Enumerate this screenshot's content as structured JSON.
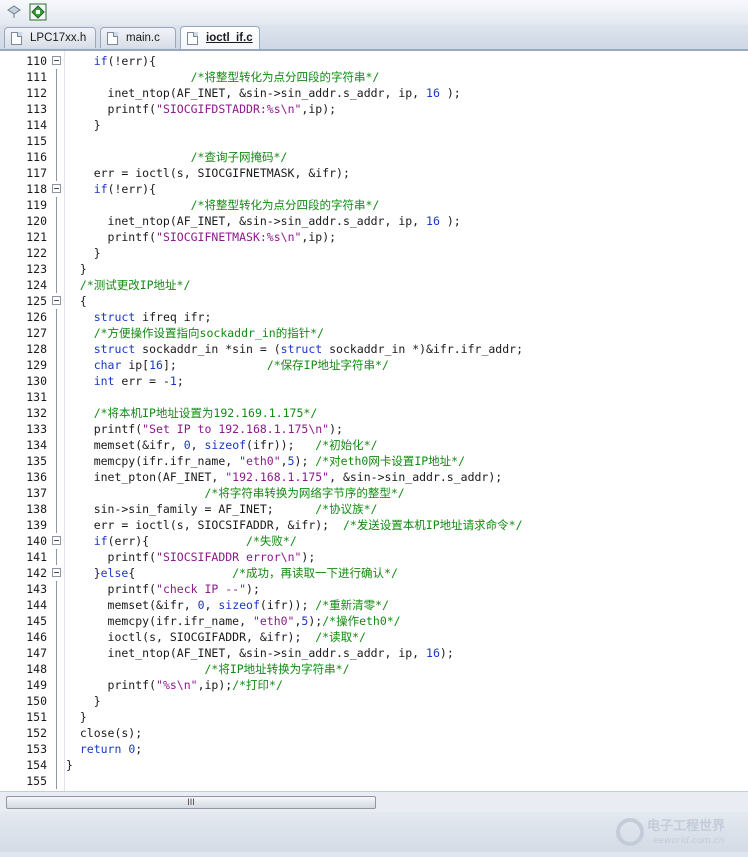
{
  "toolbar": {
    "icons": [
      "pointer-icon",
      "build-icon"
    ]
  },
  "tabs": [
    {
      "label": "LPC17xx.h",
      "active": false
    },
    {
      "label": "main.c",
      "active": false
    },
    {
      "label": "ioctl_if.c",
      "active": true
    }
  ],
  "lines": [
    {
      "n": "110",
      "fold": "box",
      "code": [
        [
          "tx",
          "    "
        ],
        [
          "kw",
          "if"
        ],
        [
          "tx",
          "(!err){"
        ]
      ]
    },
    {
      "n": "111",
      "fold": "line",
      "code": [
        [
          "tx",
          "                  "
        ],
        [
          "cm",
          "/*将整型转化为点分四段的字符串*/"
        ]
      ]
    },
    {
      "n": "112",
      "fold": "line",
      "code": [
        [
          "tx",
          "      inet_ntop(AF_INET, &sin->sin_addr.s_addr, ip, "
        ],
        [
          "num",
          "16"
        ],
        [
          "tx",
          " );"
        ]
      ]
    },
    {
      "n": "113",
      "fold": "line",
      "code": [
        [
          "tx",
          "      printf("
        ],
        [
          "str",
          "\"SIOCGIFDSTADDR:%s\\n\""
        ],
        [
          "tx",
          ",ip);"
        ]
      ]
    },
    {
      "n": "114",
      "fold": "line",
      "code": [
        [
          "tx",
          "    }"
        ]
      ]
    },
    {
      "n": "115",
      "fold": "line",
      "code": []
    },
    {
      "n": "116",
      "fold": "line",
      "code": [
        [
          "tx",
          "                  "
        ],
        [
          "cm",
          "/*查询子网掩码*/"
        ]
      ]
    },
    {
      "n": "117",
      "fold": "line",
      "code": [
        [
          "tx",
          "    err = ioctl(s, SIOCGIFNETMASK, &ifr);"
        ]
      ]
    },
    {
      "n": "118",
      "fold": "box",
      "code": [
        [
          "tx",
          "    "
        ],
        [
          "kw",
          "if"
        ],
        [
          "tx",
          "(!err){"
        ]
      ]
    },
    {
      "n": "119",
      "fold": "line",
      "code": [
        [
          "tx",
          "                  "
        ],
        [
          "cm",
          "/*将整型转化为点分四段的字符串*/"
        ]
      ]
    },
    {
      "n": "120",
      "fold": "line",
      "code": [
        [
          "tx",
          "      inet_ntop(AF_INET, &sin->sin_addr.s_addr, ip, "
        ],
        [
          "num",
          "16"
        ],
        [
          "tx",
          " );"
        ]
      ]
    },
    {
      "n": "121",
      "fold": "line",
      "code": [
        [
          "tx",
          "      printf("
        ],
        [
          "str",
          "\"SIOCGIFNETMASK:%s\\n\""
        ],
        [
          "tx",
          ",ip);"
        ]
      ]
    },
    {
      "n": "122",
      "fold": "line",
      "code": [
        [
          "tx",
          "    }"
        ]
      ]
    },
    {
      "n": "123",
      "fold": "line",
      "code": [
        [
          "tx",
          "  }"
        ]
      ]
    },
    {
      "n": "124",
      "fold": "line",
      "code": [
        [
          "tx",
          "  "
        ],
        [
          "cm",
          "/*测试更改IP地址*/"
        ]
      ]
    },
    {
      "n": "125",
      "fold": "box",
      "code": [
        [
          "tx",
          "  {"
        ]
      ]
    },
    {
      "n": "126",
      "fold": "line",
      "code": [
        [
          "tx",
          "    "
        ],
        [
          "kw",
          "struct"
        ],
        [
          "tx",
          " ifreq ifr;"
        ]
      ]
    },
    {
      "n": "127",
      "fold": "line",
      "code": [
        [
          "tx",
          "    "
        ],
        [
          "cm",
          "/*方便操作设置指向sockaddr_in的指针*/"
        ]
      ]
    },
    {
      "n": "128",
      "fold": "line",
      "code": [
        [
          "tx",
          "    "
        ],
        [
          "kw",
          "struct"
        ],
        [
          "tx",
          " sockaddr_in *sin = ("
        ],
        [
          "kw",
          "struct"
        ],
        [
          "tx",
          " sockaddr_in *)&ifr.ifr_addr;"
        ]
      ]
    },
    {
      "n": "129",
      "fold": "line",
      "code": [
        [
          "tx",
          "    "
        ],
        [
          "kw",
          "char"
        ],
        [
          "tx",
          " ip["
        ],
        [
          "num",
          "16"
        ],
        [
          "tx",
          "];             "
        ],
        [
          "cm",
          "/*保存IP地址字符串*/"
        ]
      ]
    },
    {
      "n": "130",
      "fold": "line",
      "code": [
        [
          "tx",
          "    "
        ],
        [
          "kw",
          "int"
        ],
        [
          "tx",
          " err = -"
        ],
        [
          "num",
          "1"
        ],
        [
          "tx",
          ";"
        ]
      ]
    },
    {
      "n": "131",
      "fold": "line",
      "code": []
    },
    {
      "n": "132",
      "fold": "line",
      "code": [
        [
          "tx",
          "    "
        ],
        [
          "cm",
          "/*将本机IP地址设置为192.169.1.175*/"
        ]
      ]
    },
    {
      "n": "133",
      "fold": "line",
      "code": [
        [
          "tx",
          "    printf("
        ],
        [
          "str",
          "\"Set IP to 192.168.1.175\\n\""
        ],
        [
          "tx",
          ");"
        ]
      ]
    },
    {
      "n": "134",
      "fold": "line",
      "code": [
        [
          "tx",
          "    memset(&ifr, "
        ],
        [
          "num",
          "0"
        ],
        [
          "tx",
          ", "
        ],
        [
          "kw",
          "sizeof"
        ],
        [
          "tx",
          "(ifr));   "
        ],
        [
          "cm",
          "/*初始化*/"
        ]
      ]
    },
    {
      "n": "135",
      "fold": "line",
      "code": [
        [
          "tx",
          "    memcpy(ifr.ifr_name, "
        ],
        [
          "str",
          "\"eth0\""
        ],
        [
          "tx",
          ","
        ],
        [
          "num",
          "5"
        ],
        [
          "tx",
          "); "
        ],
        [
          "cm",
          "/*对eth0网卡设置IP地址*/"
        ]
      ]
    },
    {
      "n": "136",
      "fold": "line",
      "code": [
        [
          "tx",
          "    inet_pton(AF_INET, "
        ],
        [
          "str",
          "\"192.168.1.175\""
        ],
        [
          "tx",
          ", &sin->sin_addr.s_addr);"
        ]
      ]
    },
    {
      "n": "137",
      "fold": "line",
      "code": [
        [
          "tx",
          "                    "
        ],
        [
          "cm",
          "/*将字符串转换为网络字节序的整型*/"
        ]
      ]
    },
    {
      "n": "138",
      "fold": "line",
      "code": [
        [
          "tx",
          "    sin->sin_family = AF_INET;      "
        ],
        [
          "cm",
          "/*协议族*/"
        ]
      ]
    },
    {
      "n": "139",
      "fold": "line",
      "code": [
        [
          "tx",
          "    err = ioctl(s, SIOCSIFADDR, &ifr);  "
        ],
        [
          "cm",
          "/*发送设置本机IP地址请求命令*/"
        ]
      ]
    },
    {
      "n": "140",
      "fold": "box",
      "code": [
        [
          "tx",
          "    "
        ],
        [
          "kw",
          "if"
        ],
        [
          "tx",
          "(err){              "
        ],
        [
          "cm",
          "/*失败*/"
        ]
      ]
    },
    {
      "n": "141",
      "fold": "line",
      "code": [
        [
          "tx",
          "      printf("
        ],
        [
          "str",
          "\"SIOCSIFADDR error\\n\""
        ],
        [
          "tx",
          ");"
        ]
      ]
    },
    {
      "n": "142",
      "fold": "box",
      "code": [
        [
          "tx",
          "    }"
        ],
        [
          "kw",
          "else"
        ],
        [
          "tx",
          "{              "
        ],
        [
          "cm",
          "/*成功，再读取一下进行确认*/"
        ]
      ]
    },
    {
      "n": "143",
      "fold": "line",
      "code": [
        [
          "tx",
          "      printf("
        ],
        [
          "str",
          "\"check IP --\""
        ],
        [
          "tx",
          ");"
        ]
      ]
    },
    {
      "n": "144",
      "fold": "line",
      "code": [
        [
          "tx",
          "      memset(&ifr, "
        ],
        [
          "num",
          "0"
        ],
        [
          "tx",
          ", "
        ],
        [
          "kw",
          "sizeof"
        ],
        [
          "tx",
          "(ifr)); "
        ],
        [
          "cm",
          "/*重新清零*/"
        ]
      ]
    },
    {
      "n": "145",
      "fold": "line",
      "code": [
        [
          "tx",
          "      memcpy(ifr.ifr_name, "
        ],
        [
          "str",
          "\"eth0\""
        ],
        [
          "tx",
          ","
        ],
        [
          "num",
          "5"
        ],
        [
          "tx",
          ");"
        ],
        [
          "cm",
          "/*操作eth0*/"
        ]
      ]
    },
    {
      "n": "146",
      "fold": "line",
      "code": [
        [
          "tx",
          "      ioctl(s, SIOCGIFADDR, &ifr);  "
        ],
        [
          "cm",
          "/*读取*/"
        ]
      ]
    },
    {
      "n": "147",
      "fold": "line",
      "code": [
        [
          "tx",
          "      inet_ntop(AF_INET, &sin->sin_addr.s_addr, ip, "
        ],
        [
          "num",
          "16"
        ],
        [
          "tx",
          ");"
        ]
      ]
    },
    {
      "n": "148",
      "fold": "line",
      "code": [
        [
          "tx",
          "                    "
        ],
        [
          "cm",
          "/*将IP地址转换为字符串*/"
        ]
      ]
    },
    {
      "n": "149",
      "fold": "line",
      "code": [
        [
          "tx",
          "      printf("
        ],
        [
          "str",
          "\"%s\\n\""
        ],
        [
          "tx",
          ",ip);"
        ],
        [
          "cm",
          "/*打印*/"
        ]
      ]
    },
    {
      "n": "150",
      "fold": "line",
      "code": [
        [
          "tx",
          "    }"
        ]
      ]
    },
    {
      "n": "151",
      "fold": "line",
      "code": [
        [
          "tx",
          "  }"
        ]
      ]
    },
    {
      "n": "152",
      "fold": "line",
      "code": [
        [
          "tx",
          "  close(s);"
        ]
      ]
    },
    {
      "n": "153",
      "fold": "line",
      "code": [
        [
          "tx",
          "  "
        ],
        [
          "kw",
          "return"
        ],
        [
          "tx",
          " "
        ],
        [
          "num",
          "0"
        ],
        [
          "tx",
          ";"
        ]
      ]
    },
    {
      "n": "154",
      "fold": "line",
      "code": [
        [
          "tx",
          "}"
        ]
      ]
    },
    {
      "n": "155",
      "fold": "line",
      "code": []
    }
  ],
  "scrollbar": {
    "thumb_grip": "III"
  },
  "watermark": {
    "text": "电子工程世界",
    "sub": "eeworld.com.cn"
  },
  "colors": {
    "keyword": "#1a36c8",
    "string": "#8b1a8b",
    "comment": "#138a13",
    "text": "#1a1a1a"
  }
}
